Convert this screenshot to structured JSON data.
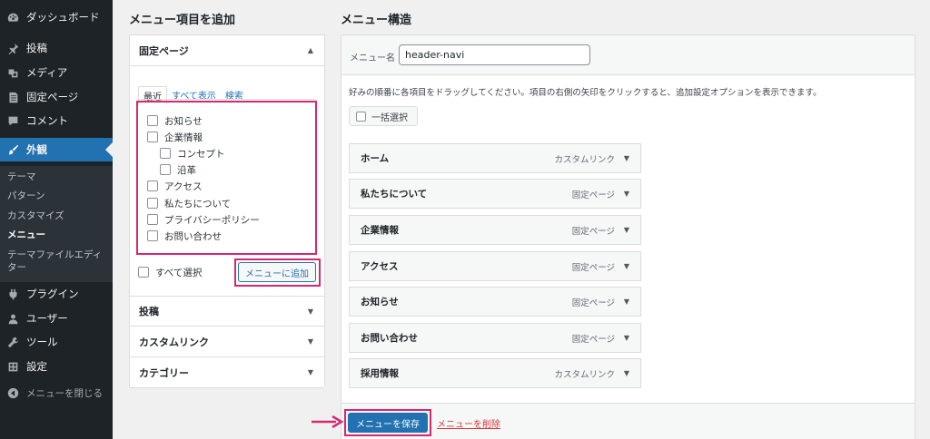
{
  "sidebar": {
    "dashboard": "ダッシュボード",
    "posts": "投稿",
    "media": "メディア",
    "pages": "固定ページ",
    "comments": "コメント",
    "appearance": "外観",
    "submenu": [
      "テーマ",
      "パターン",
      "カスタマイズ",
      "メニュー",
      "テーマファイルエディター"
    ],
    "plugins": "プラグイン",
    "users": "ユーザー",
    "tools": "ツール",
    "settings": "設定",
    "collapse": "メニューを閉じる"
  },
  "left": {
    "title": "メニュー項目を追加",
    "pages_section": "固定ページ",
    "tabs": [
      "最近",
      "すべて表示",
      "検索"
    ],
    "items": [
      "お知らせ",
      "企業情報",
      "コンセプト",
      "沿革",
      "アクセス",
      "私たちについて",
      "プライバシーポリシー",
      "お問い合わせ"
    ],
    "select_all": "すべて選択",
    "add_button": "メニューに追加",
    "sections": [
      "投稿",
      "カスタムリンク",
      "カテゴリー"
    ]
  },
  "right": {
    "title": "メニュー構造",
    "name_label": "メニュー名",
    "name_value": "header-navi",
    "instructions": "好みの順番に各項目をドラッグしてください。項目の右側の矢印をクリックすると、追加設定オプションを表示できます。",
    "bulk_select": "一括選択",
    "menu_items": [
      {
        "title": "ホーム",
        "type": "カスタムリンク"
      },
      {
        "title": "私たちについて",
        "type": "固定ページ"
      },
      {
        "title": "企業情報",
        "type": "固定ページ"
      },
      {
        "title": "アクセス",
        "type": "固定ページ"
      },
      {
        "title": "お知らせ",
        "type": "固定ページ"
      },
      {
        "title": "お問い合わせ",
        "type": "固定ページ"
      },
      {
        "title": "採用情報",
        "type": "カスタムリンク"
      }
    ],
    "save_button": "メニューを保存",
    "delete_link": "メニューを削除"
  },
  "colors": {
    "sidebar_bg": "#1d2327",
    "accent": "#2271b1",
    "highlight": "#d7276e"
  }
}
